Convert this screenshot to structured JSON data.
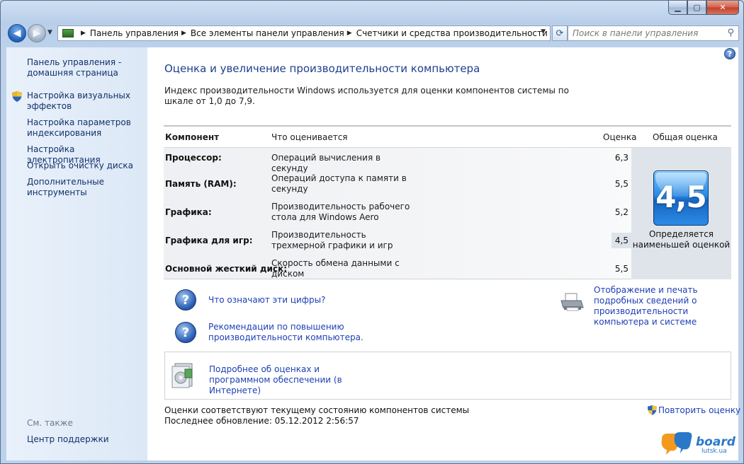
{
  "window": {
    "caption_buttons": [
      "minimize",
      "maximize",
      "close"
    ],
    "close_glyph": "✕",
    "min_glyph": "▁",
    "max_glyph": "▢"
  },
  "navigation": {
    "back_icon": "back-arrow-icon",
    "forward_icon": "forward-arrow-icon",
    "breadcrumbs": [
      "Панель управления",
      "Все элементы панели управления",
      "Счетчики и средства производительности"
    ],
    "search_placeholder": "Поиск в панели управления"
  },
  "sidebar": {
    "items": [
      {
        "label": "Панель управления - домашняя страница",
        "shield": false
      },
      {
        "label": "Настройка визуальных эффектов",
        "shield": true
      },
      {
        "label": "Настройка параметров индексирования",
        "shield": false
      },
      {
        "label": "Настройка электропитания",
        "shield": false
      },
      {
        "label": "Открыть очистку диска",
        "shield": false
      },
      {
        "label": "Дополнительные инструменты",
        "shield": false
      }
    ],
    "see_also_heading": "См. также",
    "see_also_items": [
      "Центр поддержки"
    ]
  },
  "main": {
    "title": "Оценка и увеличение производительности компьютера",
    "intro": "Индекс производительности Windows используется для оценки компонентов системы по шкале от 1,0 до 7,9.",
    "table": {
      "headers": {
        "component": "Компонент",
        "what": "Что оценивается",
        "score": "Оценка",
        "overall": "Общая оценка"
      },
      "rows": [
        {
          "component": "Процессор:",
          "what": "Операций вычисления в секунду",
          "score": "6,3",
          "lowest": false
        },
        {
          "component": "Память (RAM):",
          "what": "Операций доступа к памяти в секунду",
          "score": "5,5",
          "lowest": false
        },
        {
          "component": "Графика:",
          "what": "Производительность рабочего стола для Windows Aero",
          "score": "5,2",
          "lowest": false
        },
        {
          "component": "Графика для игр:",
          "what": "Производительность трехмерной графики и игр",
          "score": "4,5",
          "lowest": true
        },
        {
          "component": "Основной жесткий диск:",
          "what": "Скорость обмена данными с диском",
          "score": "5,5",
          "lowest": false
        }
      ],
      "overall_score": "4,5",
      "overall_caption": "Определяется наименьшей оценкой"
    },
    "links": {
      "what_numbers_mean": "Что означают эти цифры?",
      "recommendations": "Рекомендации по повышению производительности компьютера.",
      "print_details": "Отображение и печать подробных сведений о производительности компьютера и системе",
      "online_info": "Подробнее об оценках и программном обеспечении (в Интернете)"
    },
    "footer": {
      "status": "Оценки соответствуют текущему состоянию компонентов системы",
      "last_update": "Последнее обновление: 05.12.2012 2:56:57",
      "rerun": "Повторить оценку"
    }
  },
  "watermark": {
    "brand": "board",
    "domain": "lutsk.ua"
  },
  "colors": {
    "link": "#1c3fb4",
    "title": "#1e3f8c",
    "badge": "#2d8ae2"
  }
}
